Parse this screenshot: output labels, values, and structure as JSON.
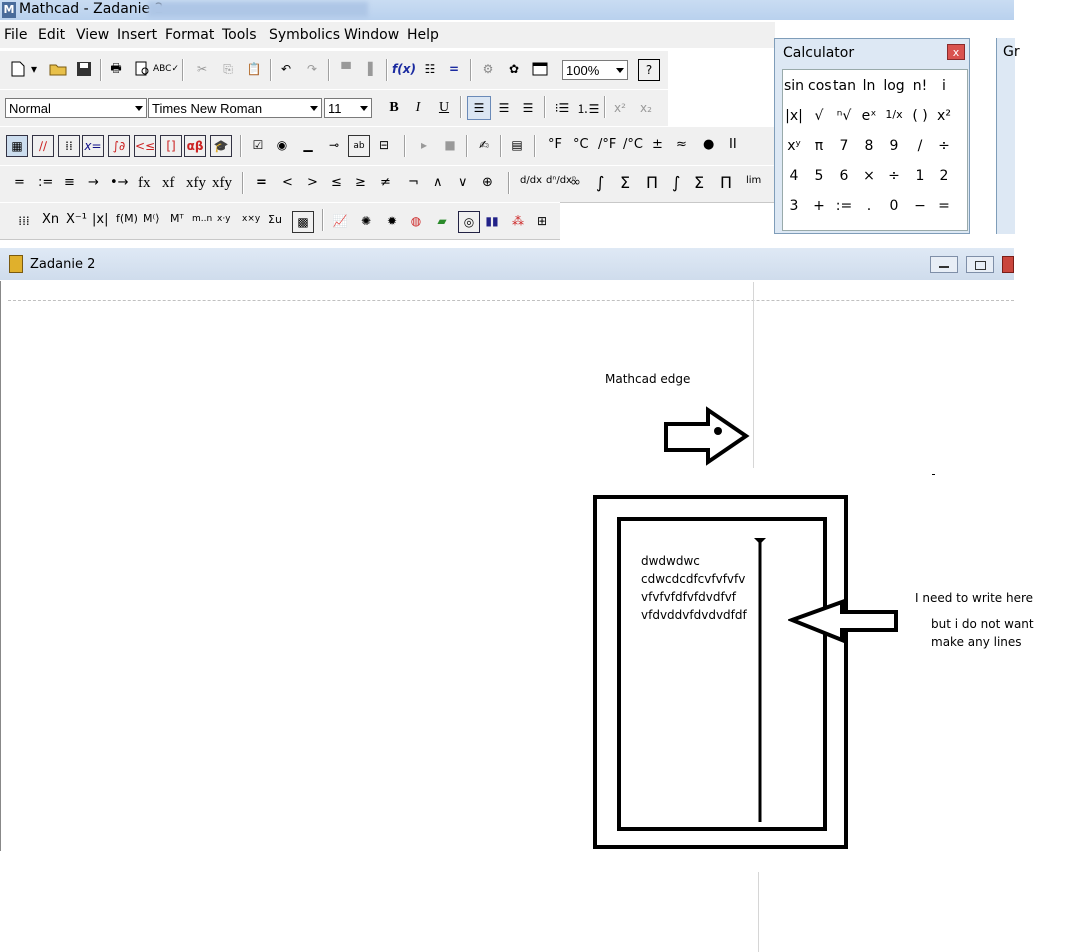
{
  "window": {
    "title": "Mathcad - Zadanie 2",
    "app_letter": "M"
  },
  "menu": [
    "File",
    "Edit",
    "View",
    "Insert",
    "Format",
    "Tools",
    "Symbolics",
    "Window",
    "Help"
  ],
  "format_toolbar": {
    "style": "Normal",
    "font": "Times New Roman",
    "size": "11",
    "bold": "B",
    "italic": "I",
    "underline": "U"
  },
  "standard_toolbar": {
    "zoom": "100%"
  },
  "math_toolbar_symbols": [
    "°F",
    "°C",
    "/°F",
    "/°C",
    "±",
    "≈",
    "●",
    "II"
  ],
  "eval_toolbar_symbols": [
    "=",
    ":=",
    "≡",
    "→",
    "•→",
    "fx",
    "xf",
    "xfy",
    "xfy",
    "=",
    "<",
    ">",
    "≤",
    "≥",
    "≠",
    "¬",
    "∧",
    "∨",
    "⊕",
    "∞",
    "∫",
    "Σ",
    "Π",
    "lim"
  ],
  "matrix_toolbar_symbols": [
    "Xn",
    "X⁻¹",
    "|x|",
    "f(M)",
    "M⁽⟩",
    "Mᵀ",
    "m..n",
    "x·y",
    "x×y",
    "Σu"
  ],
  "calculator": {
    "title": "Calculator",
    "close": "x",
    "rows": [
      [
        "sin",
        "cos",
        "tan",
        "ln",
        "log",
        "n!",
        "i"
      ],
      [
        "|x|",
        "√",
        "ⁿ√",
        "eˣ",
        "1/x",
        "( )",
        "x²"
      ],
      [
        "xʸ",
        "π",
        "7",
        "8",
        "9",
        "/",
        "÷"
      ],
      [
        "4",
        "5",
        "6",
        "×",
        "÷",
        "1",
        "2"
      ],
      [
        "3",
        "+",
        ":=",
        ".",
        "0",
        "−",
        "="
      ]
    ]
  },
  "second_panel": {
    "title": "Gr"
  },
  "document": {
    "title": "Zadanie 2"
  },
  "annotations": {
    "edge_label": "Mathcad edge",
    "box_text": [
      "dwdwdwc",
      "cdwcdcdfcvfvfvfv",
      "vfvfvfdfvfdvdfvf",
      "vfdvddvfdvdvdfdf"
    ],
    "note_line1": "I need to write here",
    "note_line2": "but i do not want",
    "note_line3": "make any lines"
  }
}
